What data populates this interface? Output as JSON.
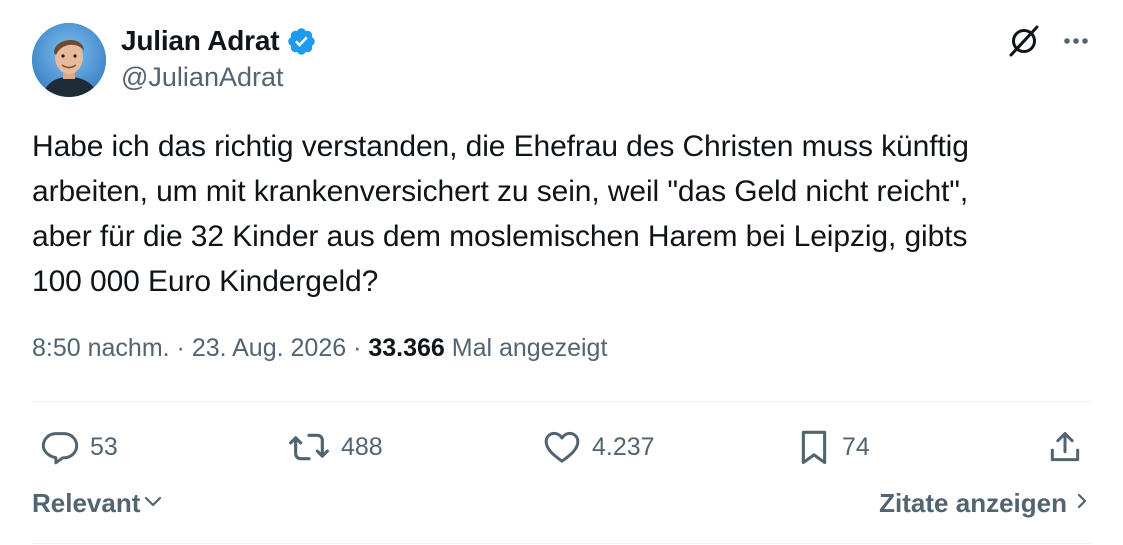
{
  "author": {
    "display_name": "Julian Adrat",
    "handle": "@JulianAdrat",
    "verified": true
  },
  "tweet": {
    "text": "Habe ich das richtig verstanden, die Ehefrau des Christen muss künftig\narbeiten, um mit krankenversichert zu sein, weil \"das Geld nicht reicht\",\naber für die 32 Kinder aus dem moslemischen Harem bei Leipzig, gibts\n100 000 Euro Kindergeld?"
  },
  "meta": {
    "time": "8:50 nachm.",
    "separator": " · ",
    "date": "23. Aug. 2026",
    "views_count": "33.366",
    "views_label": " Mal angezeigt"
  },
  "actions": {
    "replies": "53",
    "reposts": "488",
    "likes": "4.237",
    "bookmarks": "74"
  },
  "footer": {
    "sort_label": "Relevant",
    "quotes_label": "Zitate anzeigen"
  },
  "icons": {
    "verified": "verified-badge-icon",
    "grok": "grok-icon",
    "more": "more-icon",
    "reply": "reply-icon",
    "repost": "repost-icon",
    "like": "heart-icon",
    "bookmark": "bookmark-icon",
    "share": "share-icon"
  },
  "colors": {
    "text_primary": "#0f1419",
    "text_secondary": "#536471",
    "verified_blue": "#1d9bf0",
    "divider": "#eff3f4"
  }
}
